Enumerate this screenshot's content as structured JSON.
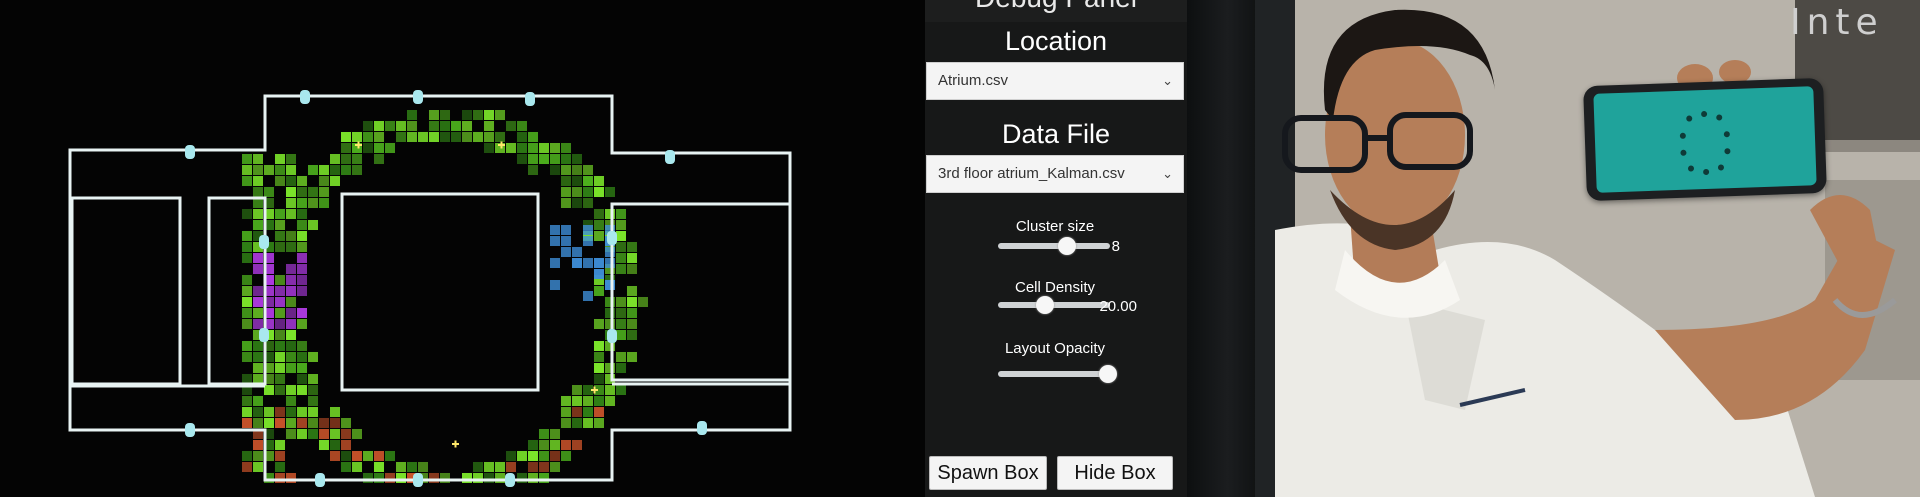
{
  "panel": {
    "title": "Debug Panel",
    "location": {
      "heading": "Location",
      "selected": "Atrium.csv"
    },
    "data_file": {
      "heading": "Data File",
      "selected": "3rd floor atrium_Kalman.csv"
    },
    "sliders": [
      {
        "label": "Cluster size",
        "value_text": "8",
        "fraction": 0.62
      },
      {
        "label": "Cell Density",
        "value_text": "20.00",
        "fraction": 0.42
      },
      {
        "label": "Layout Opacity",
        "value_text": "",
        "fraction": 0.98
      }
    ],
    "buttons": {
      "spawn": "Spawn Box",
      "hide": "Hide Box"
    }
  },
  "background_sign": "Inte",
  "colors": {
    "panel_bg": "#171818",
    "heatmap_green": "#7be52a",
    "heatmap_purple": "#b23ce6",
    "outline": "#e8f3f3",
    "marker": "#a9e8ee",
    "phone_screen": "#1fa39b"
  }
}
